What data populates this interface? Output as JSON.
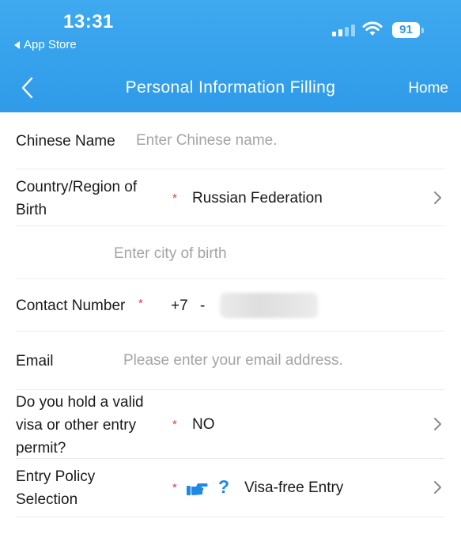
{
  "status_bar": {
    "time": "13:31",
    "back_app": "App Store",
    "battery": "91"
  },
  "nav": {
    "title": "Personal Information Filling",
    "home": "Home"
  },
  "form": {
    "chinese_name": {
      "label": "Chinese Name",
      "placeholder": "Enter Chinese name."
    },
    "country_of_birth": {
      "label_line1": "Country/Region of",
      "label_line2": "Birth",
      "required": "*",
      "value": "Russian Federation"
    },
    "city_of_birth": {
      "placeholder": "Enter city of birth"
    },
    "contact_number": {
      "label": "Contact Number",
      "required": "*",
      "country_code": "+7",
      "separator": "-"
    },
    "email": {
      "label": "Email",
      "placeholder": "Please enter your email address."
    },
    "visa": {
      "label_line1": "Do you hold a valid",
      "label_line2": "visa or other entry",
      "label_line3": "permit?",
      "required": "*",
      "value": "NO"
    },
    "entry_policy": {
      "label_line1": "Entry Policy",
      "label_line2": "Selection",
      "required": "*",
      "help_symbol": "?",
      "value": "Visa-free Entry"
    }
  },
  "colors": {
    "header": "#2f9be9",
    "required": "#e23b3b",
    "placeholder": "#a4a4a4",
    "help": "#1e88e5"
  },
  "icons": [
    "back-arrow-icon",
    "signal-icon",
    "wifi-icon",
    "battery-icon",
    "chevron-back-icon",
    "chevron-right-icon",
    "pointing-hand-icon"
  ]
}
